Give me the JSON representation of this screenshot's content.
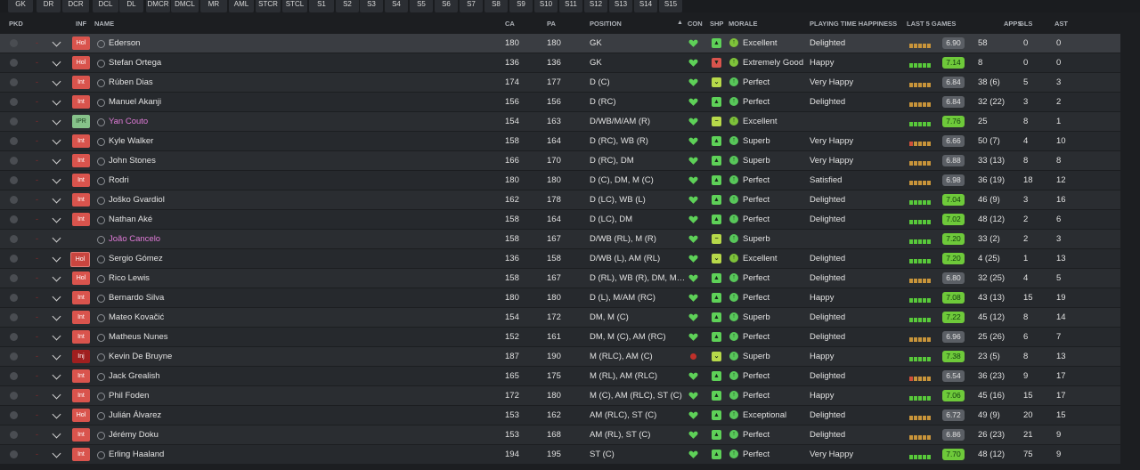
{
  "positions": [
    "GK",
    "DR",
    "DCR",
    "DCL",
    "DL",
    "DMCR",
    "DMCL",
    "MR",
    "AML",
    "STCR",
    "STCL",
    "S1",
    "S2",
    "S3",
    "S4",
    "S5",
    "S6",
    "S7",
    "S8",
    "S9",
    "S10",
    "S11",
    "S12",
    "S13",
    "S14",
    "S15"
  ],
  "header": {
    "pkd": "PKD",
    "inf": "INF",
    "name": "NAME",
    "ca": "CA",
    "pa": "PA",
    "position": "POSITION",
    "con": "CON",
    "shp": "SHP",
    "morale": "MORALE",
    "happiness": "PLAYING TIME HAPPINESS",
    "last5": "LAST 5 GAMES",
    "apps": "APPS",
    "gls": "GLS",
    "ast": "AST"
  },
  "sort_indicator": "▲",
  "players": [
    {
      "inf": "Hol",
      "name": "Ederson",
      "ca": "180",
      "pa": "180",
      "position": "GK",
      "con": "heart",
      "shp": "up",
      "morale": "Excellent",
      "happiness": "Delighted",
      "form": [
        "o",
        "o",
        "o",
        "o",
        "o"
      ],
      "rating": "6.90",
      "rating_style": "n",
      "apps": "58",
      "gls": "0",
      "ast": "0"
    },
    {
      "inf": "Hol",
      "name": "Stefan Ortega",
      "ca": "136",
      "pa": "136",
      "position": "GK",
      "con": "heart",
      "shp": "down-red",
      "morale": "Extremely Good",
      "happiness": "Happy",
      "form": [
        "g",
        "g",
        "g",
        "g",
        "g"
      ],
      "rating": "7.14",
      "rating_style": "g",
      "apps": "8",
      "gls": "0",
      "ast": "0"
    },
    {
      "inf": "Int",
      "name": "Rúben Dias",
      "ca": "174",
      "pa": "177",
      "position": "D (C)",
      "con": "heart",
      "shp": "v",
      "morale": "Perfect",
      "happiness": "Very Happy",
      "form": [
        "o",
        "o",
        "o",
        "o",
        "o"
      ],
      "rating": "6.84",
      "rating_style": "n",
      "apps": "38 (6)",
      "gls": "5",
      "ast": "3"
    },
    {
      "inf": "Int",
      "name": "Manuel Akanji",
      "ca": "156",
      "pa": "156",
      "position": "D (RC)",
      "con": "heart",
      "shp": "up",
      "morale": "Perfect",
      "happiness": "Delighted",
      "form": [
        "o",
        "o",
        "o",
        "o",
        "o"
      ],
      "rating": "6.84",
      "rating_style": "n",
      "apps": "32 (22)",
      "gls": "3",
      "ast": "2"
    },
    {
      "inf": "IPR",
      "name": "Yan Couto",
      "ca": "154",
      "pa": "163",
      "position": "D/WB/M/AM (R)",
      "con": "heart",
      "shp": "minus",
      "morale": "Excellent",
      "happiness": "",
      "form": [
        "g",
        "g",
        "g",
        "g",
        "g"
      ],
      "rating": "7.76",
      "rating_style": "g",
      "apps": "25",
      "gls": "8",
      "ast": "1"
    },
    {
      "inf": "Int",
      "name": "Kyle Walker",
      "ca": "158",
      "pa": "164",
      "position": "D (RC), WB (R)",
      "con": "heart",
      "shp": "up",
      "morale": "Superb",
      "happiness": "Very Happy",
      "form": [
        "r",
        "o",
        "o",
        "o",
        "o"
      ],
      "rating": "6.66",
      "rating_style": "n",
      "apps": "50 (7)",
      "gls": "4",
      "ast": "10"
    },
    {
      "inf": "Int",
      "name": "John Stones",
      "ca": "166",
      "pa": "170",
      "position": "D (RC), DM",
      "con": "heart",
      "shp": "up",
      "morale": "Superb",
      "happiness": "Very Happy",
      "form": [
        "o",
        "o",
        "o",
        "o",
        "o"
      ],
      "rating": "6.88",
      "rating_style": "n",
      "apps": "33 (13)",
      "gls": "8",
      "ast": "8"
    },
    {
      "inf": "Int",
      "name": "Rodri",
      "ca": "180",
      "pa": "180",
      "position": "D (C), DM, M (C)",
      "con": "heart",
      "shp": "up",
      "morale": "Perfect",
      "happiness": "Satisfied",
      "form": [
        "o",
        "o",
        "o",
        "o",
        "o"
      ],
      "rating": "6.98",
      "rating_style": "n",
      "apps": "36 (19)",
      "gls": "18",
      "ast": "12"
    },
    {
      "inf": "Int",
      "name": "Joško Gvardiol",
      "ca": "162",
      "pa": "178",
      "position": "D (LC), WB (L)",
      "con": "heart",
      "shp": "up",
      "morale": "Perfect",
      "happiness": "Delighted",
      "form": [
        "g",
        "g",
        "g",
        "g",
        "g"
      ],
      "rating": "7.04",
      "rating_style": "g",
      "apps": "46 (9)",
      "gls": "3",
      "ast": "16"
    },
    {
      "inf": "Int",
      "name": "Nathan Aké",
      "ca": "158",
      "pa": "164",
      "position": "D (LC), DM",
      "con": "heart",
      "shp": "up",
      "morale": "Perfect",
      "happiness": "Delighted",
      "form": [
        "g",
        "g",
        "g",
        "g",
        "g"
      ],
      "rating": "7.02",
      "rating_style": "g",
      "apps": "48 (12)",
      "gls": "2",
      "ast": "6"
    },
    {
      "inf": "",
      "name": "João Cancelo",
      "ca": "158",
      "pa": "167",
      "position": "D/WB (RL), M (R)",
      "con": "heart",
      "shp": "minus",
      "morale": "Superb",
      "happiness": "",
      "form": [
        "g",
        "g",
        "g",
        "g",
        "g"
      ],
      "rating": "7.20",
      "rating_style": "g",
      "apps": "33 (2)",
      "gls": "2",
      "ast": "3"
    },
    {
      "inf": "Hol",
      "name": "Sergio Gómez",
      "ca": "136",
      "pa": "158",
      "position": "D/WB (L), AM (RL)",
      "con": "heart",
      "shp": "v",
      "morale": "Excellent",
      "happiness": "Delighted",
      "form": [
        "g",
        "g",
        "g",
        "g",
        "g"
      ],
      "rating": "7.20",
      "rating_style": "g",
      "apps": "4 (25)",
      "gls": "1",
      "ast": "13"
    },
    {
      "inf": "Hol",
      "name": "Rico Lewis",
      "ca": "158",
      "pa": "167",
      "position": "D (RL), WB (R), DM, M…",
      "con": "heart",
      "shp": "up",
      "morale": "Perfect",
      "happiness": "Delighted",
      "form": [
        "o",
        "o",
        "o",
        "o",
        "o"
      ],
      "rating": "6.80",
      "rating_style": "n",
      "apps": "32 (25)",
      "gls": "4",
      "ast": "5"
    },
    {
      "inf": "Int",
      "name": "Bernardo Silva",
      "ca": "180",
      "pa": "180",
      "position": "D (L), M/AM (RC)",
      "con": "heart",
      "shp": "up",
      "morale": "Perfect",
      "happiness": "Happy",
      "form": [
        "g",
        "g",
        "g",
        "g",
        "g"
      ],
      "rating": "7.08",
      "rating_style": "g",
      "apps": "43 (13)",
      "gls": "15",
      "ast": "19"
    },
    {
      "inf": "Int",
      "name": "Mateo Kovačić",
      "ca": "154",
      "pa": "172",
      "position": "DM, M (C)",
      "con": "heart",
      "shp": "up",
      "morale": "Superb",
      "happiness": "Delighted",
      "form": [
        "g",
        "g",
        "g",
        "g",
        "g"
      ],
      "rating": "7.22",
      "rating_style": "g",
      "apps": "45 (12)",
      "gls": "8",
      "ast": "14"
    },
    {
      "inf": "Int",
      "name": "Matheus Nunes",
      "ca": "152",
      "pa": "161",
      "position": "DM, M (C), AM (RC)",
      "con": "heart",
      "shp": "up",
      "morale": "Perfect",
      "happiness": "Delighted",
      "form": [
        "o",
        "o",
        "o",
        "o",
        "o"
      ],
      "rating": "6.96",
      "rating_style": "n",
      "apps": "25 (26)",
      "gls": "6",
      "ast": "7"
    },
    {
      "inf": "Inj",
      "name": "Kevin De Bruyne",
      "ca": "187",
      "pa": "190",
      "position": "M (RLC), AM (C)",
      "con": "injury",
      "shp": "v",
      "morale": "Superb",
      "happiness": "Happy",
      "form": [
        "g",
        "g",
        "g",
        "g",
        "g"
      ],
      "rating": "7.38",
      "rating_style": "g",
      "apps": "23 (5)",
      "gls": "8",
      "ast": "13"
    },
    {
      "inf": "Int",
      "name": "Jack Grealish",
      "ca": "165",
      "pa": "175",
      "position": "M (RL), AM (RLC)",
      "con": "heart",
      "shp": "up",
      "morale": "Perfect",
      "happiness": "Delighted",
      "form": [
        "r",
        "o",
        "o",
        "o",
        "o"
      ],
      "rating": "6.54",
      "rating_style": "n",
      "apps": "36 (23)",
      "gls": "9",
      "ast": "17"
    },
    {
      "inf": "Int",
      "name": "Phil Foden",
      "ca": "172",
      "pa": "180",
      "position": "M (C), AM (RLC), ST (C)",
      "con": "heart",
      "shp": "up",
      "morale": "Perfect",
      "happiness": "Happy",
      "form": [
        "g",
        "g",
        "g",
        "g",
        "g"
      ],
      "rating": "7.06",
      "rating_style": "g",
      "apps": "45 (16)",
      "gls": "15",
      "ast": "17"
    },
    {
      "inf": "Hol",
      "name": "Julián Álvarez",
      "ca": "153",
      "pa": "162",
      "position": "AM (RLC), ST (C)",
      "con": "heart",
      "shp": "up",
      "morale": "Exceptional",
      "happiness": "Delighted",
      "form": [
        "o",
        "o",
        "o",
        "o",
        "o"
      ],
      "rating": "6.72",
      "rating_style": "n",
      "apps": "49 (9)",
      "gls": "20",
      "ast": "15"
    },
    {
      "inf": "Int",
      "name": "Jérémy Doku",
      "ca": "153",
      "pa": "168",
      "position": "AM (RL), ST (C)",
      "con": "heart",
      "shp": "up",
      "morale": "Perfect",
      "happiness": "Delighted",
      "form": [
        "o",
        "o",
        "o",
        "o",
        "o"
      ],
      "rating": "6.86",
      "rating_style": "n",
      "apps": "26 (23)",
      "gls": "21",
      "ast": "9"
    },
    {
      "inf": "Int",
      "name": "Erling Haaland",
      "ca": "194",
      "pa": "195",
      "position": "ST (C)",
      "con": "heart",
      "shp": "up",
      "morale": "Perfect",
      "happiness": "Very Happy",
      "form": [
        "g",
        "g",
        "g",
        "g",
        "g"
      ],
      "rating": "7.70",
      "rating_style": "g",
      "apps": "48 (12)",
      "gls": "75",
      "ast": "9"
    }
  ],
  "icons": {
    "con": "heart-icon",
    "injury": "injury-icon",
    "shp": "sharpness-icon",
    "morale": "morale-icon"
  },
  "colors": {
    "good": "#6ec93a",
    "neutral_rating": "#5b5f65",
    "form_green": "#58c93a",
    "form_orange": "#c8943a",
    "form_red": "#d0503a",
    "badge_red": "#d9544d",
    "badge_ipr": "#86c28a",
    "injury": "#c0302a"
  }
}
